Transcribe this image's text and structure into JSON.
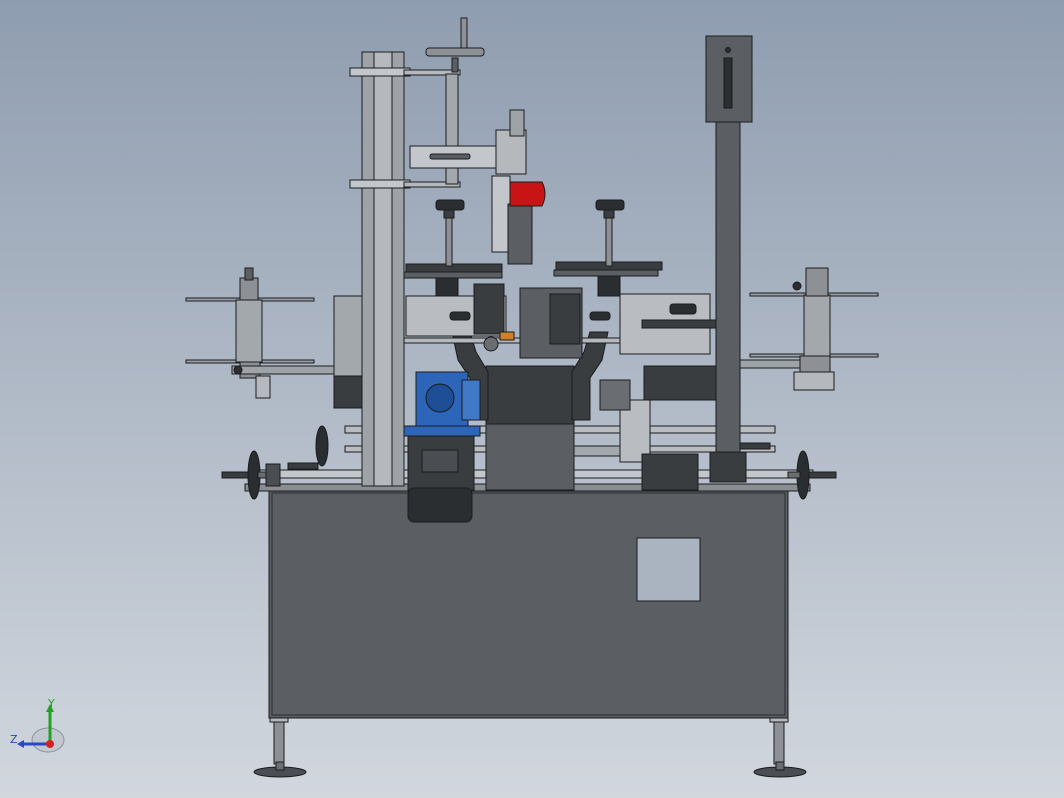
{
  "viewport": {
    "background_top": "#8f9db0",
    "background_bottom": "#d2d7de"
  },
  "model": {
    "frame_color": "#5b5f64",
    "frame_edge_color": "#1a1c1e",
    "column_color": "#9ea3a8",
    "dark_block_color": "#3a3d40",
    "gearbox_color": "#2d66b8",
    "label_roll_color": "#c81414",
    "inspection_window_color": "#a9b4c0"
  },
  "triad": {
    "y_axis": {
      "label": "Y",
      "color": "#22a022"
    },
    "z_axis": {
      "label": "Z",
      "color": "#2848c8"
    },
    "origin_color": "#d42020"
  }
}
